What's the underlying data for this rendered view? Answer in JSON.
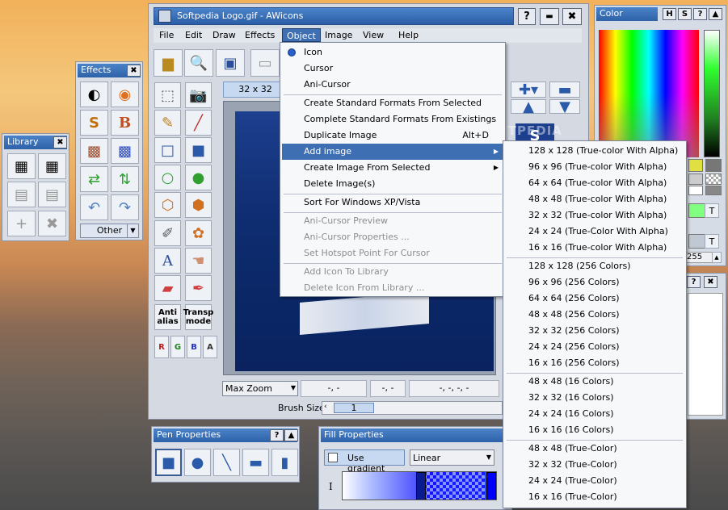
{
  "window": {
    "title": "Softpedia Logo.gif - AWicons"
  },
  "menubar": [
    {
      "label": "File"
    },
    {
      "label": "Edit"
    },
    {
      "label": "Draw"
    },
    {
      "label": "Effects"
    },
    {
      "label": "Object"
    },
    {
      "label": "Image"
    },
    {
      "label": "View"
    },
    {
      "label": "Help"
    }
  ],
  "library": {
    "title": "Library"
  },
  "effects": {
    "title": "Effects",
    "other_label": "Other"
  },
  "color": {
    "title": "Color",
    "value_255": "255"
  },
  "tools": {
    "antialias_label": "Anti\nalias",
    "transparent_label": "Transp\nmode",
    "channels": [
      "R",
      "G",
      "B",
      "A"
    ]
  },
  "canvas": {
    "size_label": "32 x 32",
    "zoom_value": "Max Zoom",
    "coord1": "-, -",
    "coord2": "-, -",
    "coord3": "-, -, -, -",
    "brush_size_label": "Brush Size",
    "brush_size_value": "1"
  },
  "watermark": "SOFTPEDIA",
  "pen_properties": {
    "title": "Pen Properties"
  },
  "fill_properties": {
    "title": "Fill Properties",
    "use_gradient_label": "Use gradient",
    "gradient_type": "Linear",
    "letter": "I"
  },
  "object_menu": {
    "items": [
      {
        "label": "Icon",
        "disabled": false
      },
      {
        "label": "Cursor",
        "disabled": false
      },
      {
        "label": "Ani-Cursor",
        "disabled": false
      },
      {
        "label": "Create Standard Formats From Selected",
        "disabled": false
      },
      {
        "label": "Complete Standard Formats From Existings",
        "disabled": false
      },
      {
        "label": "Duplicate Image",
        "shortcut": "Alt+D",
        "disabled": false
      },
      {
        "label": "Add image",
        "disabled": false
      },
      {
        "label": "Create Image From Selected",
        "disabled": false
      },
      {
        "label": "Delete Image(s)",
        "disabled": false
      },
      {
        "label": "Sort For Windows XP/Vista",
        "disabled": false
      },
      {
        "label": "Ani-Cursor Preview",
        "disabled": true
      },
      {
        "label": "Ani-Cursor Properties ...",
        "disabled": true
      },
      {
        "label": "Set Hotspot Point For Cursor",
        "disabled": true
      },
      {
        "label": "Add Icon To Library",
        "disabled": true
      },
      {
        "label": "Delete Icon From Library ...",
        "disabled": true
      }
    ]
  },
  "add_image_submenu": {
    "items": [
      "128 x 128 (True-color With Alpha)",
      "96 x 96 (True-color With Alpha)",
      "64 x 64 (True-color With Alpha)",
      "48 x 48 (True-color With Alpha)",
      "32 x 32 (True-color With Alpha)",
      "24 x 24 (True-Color With Alpha)",
      "16 x 16 (True-color With Alpha)",
      "128 x 128 (256 Colors)",
      "96 x 96 (256 Colors)",
      "64 x 64 (256 Colors)",
      "48 x 48 (256 Colors)",
      "32 x 32 (256 Colors)",
      "24 x 24 (256 Colors)",
      "16 x 16 (256 Colors)",
      "48 x 48 (16 Colors)",
      "32 x 32 (16 Colors)",
      "24 x 24 (16 Colors)",
      "16 x 16 (16 Colors)",
      "48 x 48 (True-Color)",
      "32 x 32 (True-Color)",
      "24 x 24 (True-Color)",
      "16 x 16 (True-Color)"
    ]
  }
}
